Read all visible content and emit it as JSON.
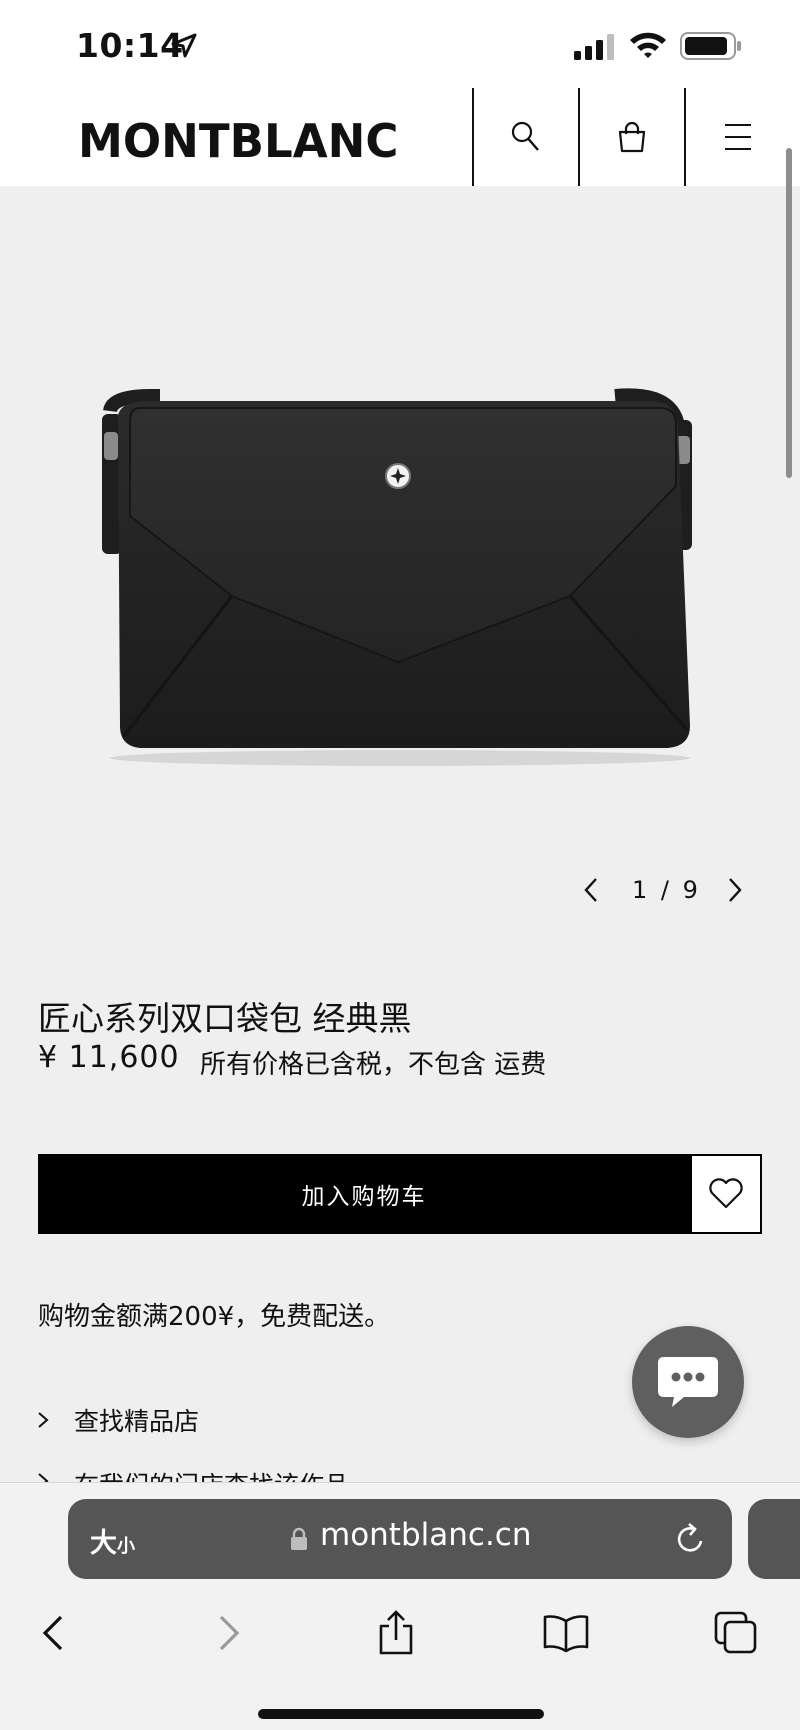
{
  "status_bar": {
    "time": "10:14"
  },
  "header": {
    "logo": "MONTBLANC"
  },
  "product": {
    "pager": "1 / 9",
    "title": "匠心系列双口袋包 经典黑",
    "price": "¥ 11,600",
    "tax_note": "所有价格已含税，不包含 运费",
    "add_to_cart_label": "加入购物车",
    "shipping_note": "购物金额满200¥，免费配送。"
  },
  "links": [
    {
      "label": "查找精品店"
    },
    {
      "label": "在我们的门店查找该作品"
    }
  ],
  "browser": {
    "text_size_label": "大",
    "text_size_small": "小",
    "url": "montblanc.cn"
  },
  "colors": {
    "brand": "#111111",
    "page_bg": "#efefef",
    "url_bar": "#555555",
    "chat": "#5f5f5f"
  },
  "icons": [
    "location-arrow-icon",
    "signal-icon",
    "wifi-icon",
    "battery-icon",
    "search-icon",
    "shopping-bag-icon",
    "menu-icon",
    "chevron-left-icon",
    "chevron-right-icon",
    "heart-icon",
    "chat-icon",
    "lock-icon",
    "reload-icon",
    "back-icon",
    "forward-icon",
    "share-icon",
    "bookmarks-icon",
    "tabs-icon"
  ]
}
